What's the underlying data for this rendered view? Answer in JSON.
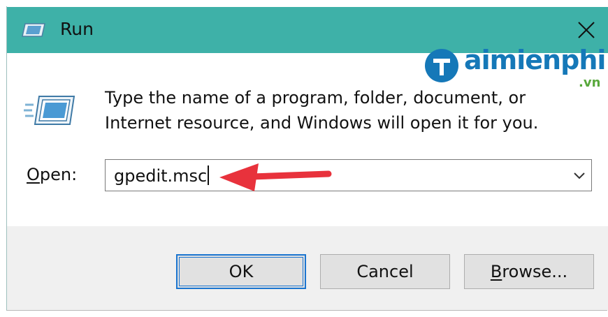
{
  "window": {
    "title": "Run",
    "title_bar_color": "#3eb1a8"
  },
  "description": "Type the name of a program, folder, document, or Internet resource, and Windows will open it for you.",
  "open_field": {
    "label_mnemonic": "O",
    "label_rest": "pen:",
    "value": "gpedit.msc"
  },
  "buttons": {
    "ok": "OK",
    "cancel": "Cancel",
    "browse_mnemonic": "B",
    "browse_rest": "rowse..."
  },
  "watermark": {
    "name": "aimienphi",
    "domain": ".vn"
  },
  "annotation": {
    "arrow_color": "#e8323c"
  },
  "icons": [
    "run-app-icon",
    "close-icon",
    "run-dialog-icon",
    "chevron-down-icon",
    "arrow-annotation",
    "taimienphi-logo"
  ]
}
